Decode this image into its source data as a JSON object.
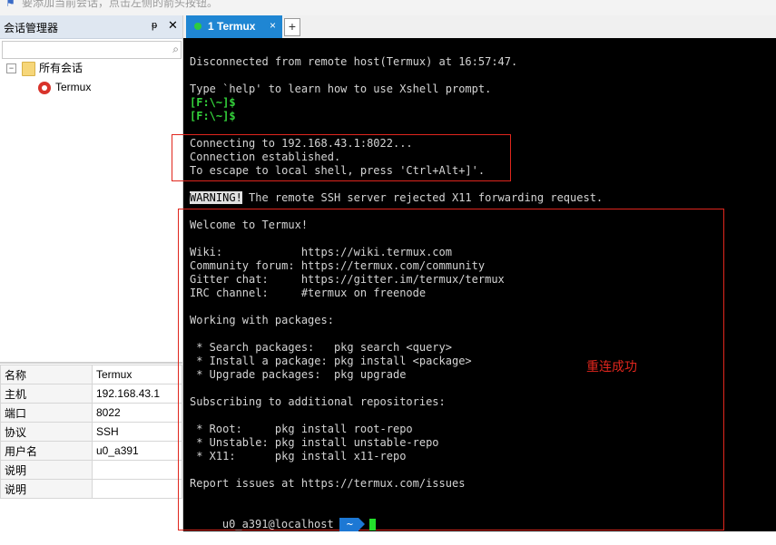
{
  "topbar": {
    "hint": "要添加当前会话，点击左侧的箭头按钮。"
  },
  "left_panel": {
    "title": "会话管理器",
    "pin_glyph": "ᵽ",
    "close_glyph": "✕",
    "search_placeholder": "",
    "tree": {
      "root_label": "所有会话",
      "child_label": "Termux",
      "toggle": "−"
    }
  },
  "properties": [
    {
      "key": "名称",
      "value": "Termux"
    },
    {
      "key": "主机",
      "value": "192.168.43.1"
    },
    {
      "key": "端口",
      "value": "8022"
    },
    {
      "key": "协议",
      "value": "SSH"
    },
    {
      "key": "用户名",
      "value": "u0_a391"
    },
    {
      "key": "说明",
      "value": ""
    },
    {
      "key": "说明",
      "value": ""
    }
  ],
  "tabs": {
    "active_label": "1 Termux",
    "close_glyph": "×",
    "add_glyph": "+"
  },
  "terminal": {
    "lines": [
      "Disconnected from remote host(Termux) at 16:57:47.",
      "",
      "Type `help' to learn how to use Xshell prompt.",
      "[F:\\~]$",
      "[F:\\~]$",
      "",
      "Connecting to 192.168.43.1:8022...",
      "Connection established.",
      "To escape to local shell, press 'Ctrl+Alt+]'.",
      "",
      "WARNING!",
      "",
      "Welcome to Termux!",
      "",
      "Wiki:            https://wiki.termux.com",
      "Community forum: https://termux.com/community",
      "Gitter chat:     https://gitter.im/termux/termux",
      "IRC channel:     #termux on freenode",
      "",
      "Working with packages:",
      "",
      " * Search packages:   pkg search <query>",
      " * Install a package: pkg install <package>",
      " * Upgrade packages:  pkg upgrade",
      "",
      "Subscribing to additional repositories:",
      "",
      " * Root:     pkg install root-repo",
      " * Unstable: pkg install unstable-repo",
      " * X11:      pkg install x11-repo",
      "",
      "Report issues at https://termux.com/issues"
    ],
    "warning_rest": " The remote SSH server rejected X11 forwarding request.",
    "prompt_user": "u0_a391@localhost",
    "prompt_dir": "~",
    "annotation": "重连成功",
    "colors": {
      "background": "#000000",
      "text": "#d4d4d4",
      "prompt_green": "#34d33b",
      "annotation_red": "#e0261d",
      "tab_blue": "#1f86d3"
    }
  }
}
